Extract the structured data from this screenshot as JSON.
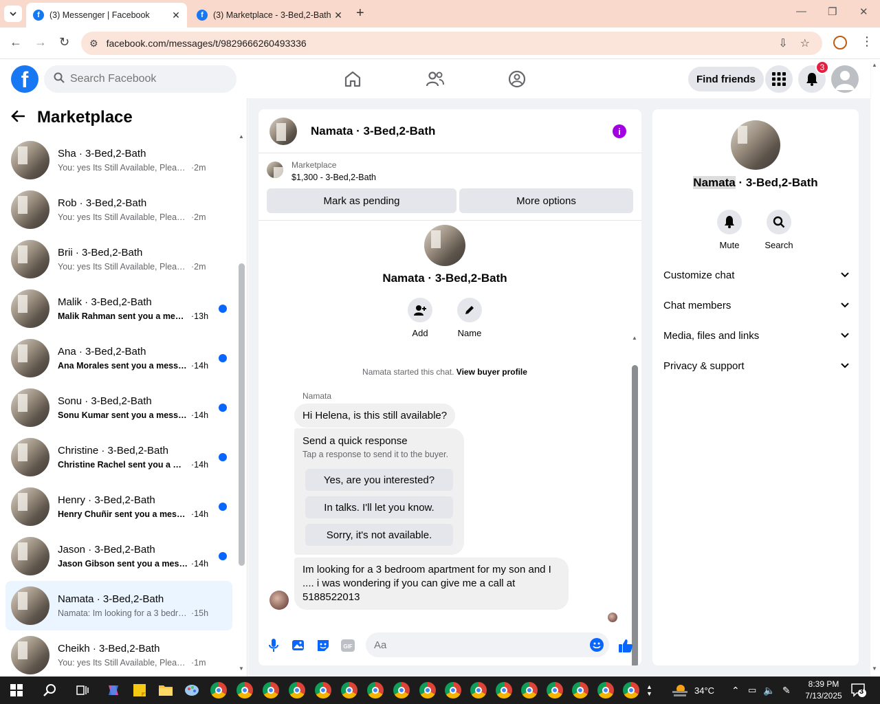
{
  "browser": {
    "tabs": [
      {
        "title": "(3) Messenger | Facebook",
        "active": true
      },
      {
        "title": "(3) Marketplace - 3-Bed,2-Bath",
        "active": false
      }
    ],
    "url": "facebook.com/messages/t/9829666260493336"
  },
  "header": {
    "search_placeholder": "Search Facebook",
    "find_friends": "Find friends",
    "notification_count": "3",
    "brand_color": "#1877f2"
  },
  "sidebar": {
    "title": "Marketplace",
    "conversations": [
      {
        "name": "Sha · 3-Bed,2-Bath",
        "snippet": "You: yes Its Still Available, Please S...",
        "time": "·2m",
        "unread": false,
        "selected": false
      },
      {
        "name": "Rob · 3-Bed,2-Bath",
        "snippet": "You: yes Its Still Available, Please S...",
        "time": "·2m",
        "unread": false,
        "selected": false
      },
      {
        "name": "Brii · 3-Bed,2-Bath",
        "snippet": "You: yes Its Still Available, Please S...",
        "time": "·2m",
        "unread": false,
        "selected": false
      },
      {
        "name": "Malik · 3-Bed,2-Bath",
        "snippet": "Malik Rahman sent you a mess...",
        "time": "·13h",
        "unread": true,
        "selected": false
      },
      {
        "name": "Ana · 3-Bed,2-Bath",
        "snippet": "Ana Morales sent you a messa...",
        "time": "·14h",
        "unread": true,
        "selected": false
      },
      {
        "name": "Sonu · 3-Bed,2-Bath",
        "snippet": "Sonu Kumar sent you a messa...",
        "time": "·14h",
        "unread": true,
        "selected": false
      },
      {
        "name": "Christine · 3-Bed,2-Bath",
        "snippet": "Christine Rachel sent you a me...",
        "time": "·14h",
        "unread": true,
        "selected": false
      },
      {
        "name": "Henry · 3-Bed,2-Bath",
        "snippet": "Henry Chuñir sent you a messa...",
        "time": "·14h",
        "unread": true,
        "selected": false
      },
      {
        "name": "Jason · 3-Bed,2-Bath",
        "snippet": "Jason Gibson sent you a messa...",
        "time": "·14h",
        "unread": true,
        "selected": false
      },
      {
        "name": "Namata · 3-Bed,2-Bath",
        "snippet": "Namata: Im looking for a 3 bedro...",
        "time": "·15h",
        "unread": false,
        "selected": true
      },
      {
        "name": "Cheikh · 3-Bed,2-Bath",
        "snippet": "You: yes Its Still Available, Please S...",
        "time": "·1m",
        "unread": false,
        "selected": false
      }
    ]
  },
  "chat": {
    "title": "Namata · 3-Bed,2-Bath",
    "listing_label": "Marketplace",
    "listing_price": "$1,300 - 3-Bed,2-Bath",
    "mark_pending": "Mark as pending",
    "more_options": "More options",
    "profile_name": "Namata · 3-Bed,2-Bath",
    "add_label": "Add",
    "name_label": "Name",
    "started_text": "Namata started this chat.",
    "view_buyer_profile": "View buyer profile",
    "sender": "Namata",
    "message1": "Hi Helena, is this still available?",
    "quick_title": "Send a quick response",
    "quick_sub": "Tap a response to send it to the buyer.",
    "quick_replies": [
      "Yes, are you interested?",
      "In talks. I'll let you know.",
      "Sorry, it's not available."
    ],
    "message2": "Im looking  for a 3 bedroom apartment  for my son and I .... i was wondering  if you can give me a call at 5188522013",
    "composer_placeholder": "Aa"
  },
  "details": {
    "name_highlight": "Namata",
    "name_rest": " · 3-Bed,2-Bath",
    "mute": "Mute",
    "search": "Search",
    "sections": [
      "Customize chat",
      "Chat members",
      "Media, files and links",
      "Privacy & support"
    ]
  },
  "taskbar": {
    "temperature": "34°C",
    "time": "8:39 PM",
    "date": "7/13/2025",
    "notifications": "3"
  }
}
